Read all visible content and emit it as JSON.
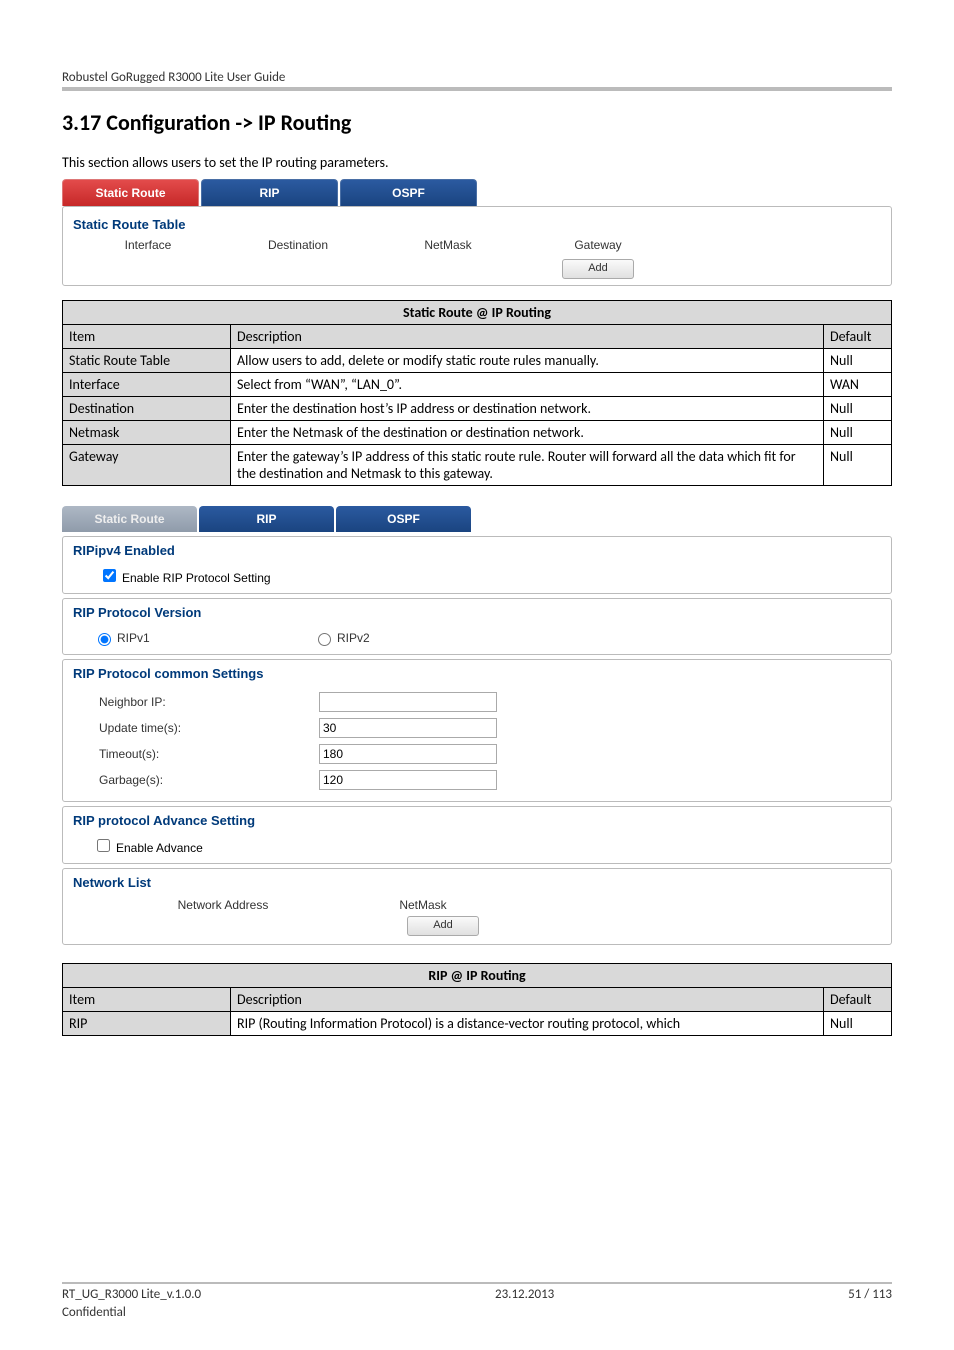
{
  "header": "Robustel GoRugged R3000 Lite User Guide",
  "heading": "3.17  Configuration -> IP Routing",
  "intro": "This section allows users to set the IP routing parameters.",
  "scr1": {
    "tabs": [
      "Static Route",
      "RIP",
      "OSPF"
    ],
    "panel_title": "Static Route Table",
    "cols": [
      "Interface",
      "Destination",
      "NetMask",
      "Gateway"
    ],
    "add": "Add"
  },
  "table1": {
    "caption": "Static Route @ IP Routing",
    "head": [
      "Item",
      "Description",
      "Default"
    ],
    "rows": [
      [
        "Static Route Table",
        "Allow users to add, delete or modify static route rules manually.",
        "Null"
      ],
      [
        "Interface",
        "Select from “WAN”, “LAN_0”.",
        "WAN"
      ],
      [
        "Destination",
        "Enter the destination host’s IP address or destination network.",
        "Null"
      ],
      [
        "Netmask",
        "Enter the Netmask of the destination or destination network.",
        "Null"
      ],
      [
        "Gateway",
        "Enter the gateway’s IP address of this static route rule. Router will forward all the data which fit for the destination and Netmask to this gateway.",
        "Null"
      ]
    ]
  },
  "scr2": {
    "tabs": [
      "Static Route",
      "RIP",
      "OSPF"
    ],
    "sec1_title": "RIPipv4 Enabled",
    "sec1_cb": "Enable RIP Protocol Setting",
    "sec2_title": "RIP Protocol Version",
    "sec2_opts": [
      "RIPv1",
      "RIPv2"
    ],
    "sec3_title": "RIP Protocol common Settings",
    "sec3_rows": [
      {
        "label": "Neighbor IP:",
        "value": ""
      },
      {
        "label": "Update time(s):",
        "value": "30"
      },
      {
        "label": "Timeout(s):",
        "value": "180"
      },
      {
        "label": "Garbage(s):",
        "value": "120"
      }
    ],
    "sec4_title": "RIP protocol Advance Setting",
    "sec4_cb": "Enable Advance",
    "sec5_title": "Network List",
    "sec5_cols": [
      "Network Address",
      "NetMask"
    ],
    "add": "Add"
  },
  "table2": {
    "caption": "RIP @ IP Routing",
    "head": [
      "Item",
      "Description",
      "Default"
    ],
    "rows": [
      [
        "RIP",
        "RIP (Routing Information Protocol) is a distance-vector routing protocol, which",
        "Null"
      ]
    ]
  },
  "footer": {
    "left": "RT_UG_R3000 Lite_v.1.0.0",
    "center": "23.12.2013",
    "right": "51 / 113",
    "conf": "Confidential"
  }
}
